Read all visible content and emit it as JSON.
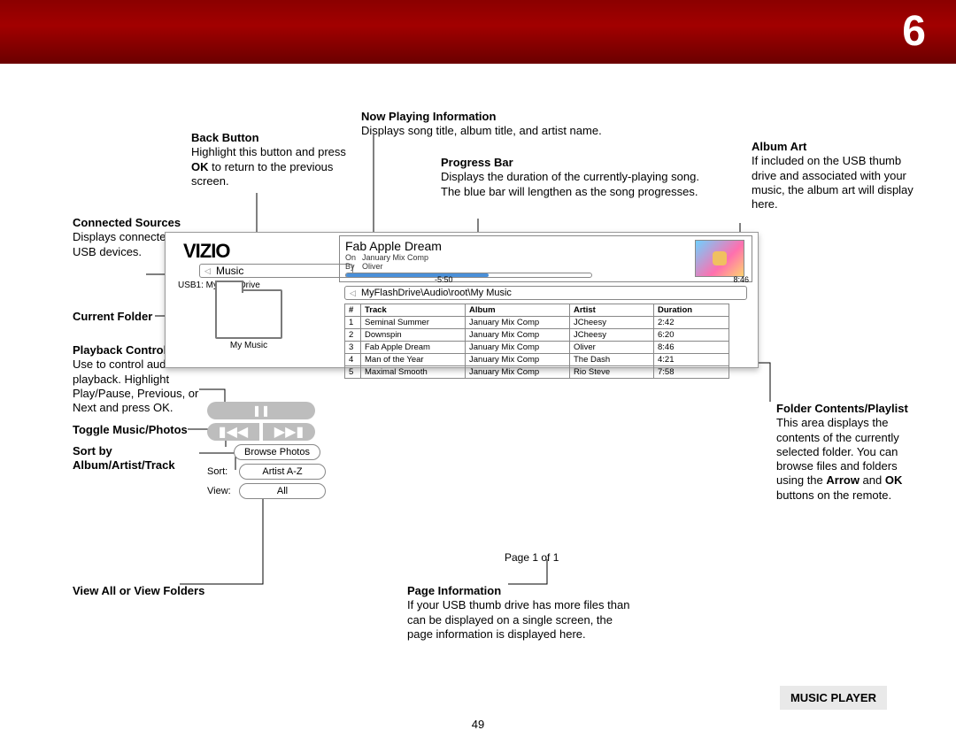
{
  "chapter": "6",
  "page_number": "49",
  "section_label": "MUSIC PLAYER",
  "callouts": {
    "back_button": {
      "title": "Back Button",
      "body": "Highlight this button and press ",
      "bold": "OK",
      "body2": " to return to the previous screen."
    },
    "now_playing": {
      "title": "Now Playing Information",
      "body": "Displays song title, album title, and artist name."
    },
    "progress": {
      "title": "Progress Bar",
      "body": "Displays the duration of the currently-playing song. The blue bar will lengthen as the song progresses."
    },
    "album_art": {
      "title": "Album Art",
      "body": "If included on the USB thumb drive and associated with your music, the album art will display here."
    },
    "connected": {
      "title": "Connected Sources",
      "body": "Displays connected USB devices."
    },
    "current_folder": {
      "title": "Current Folder"
    },
    "playback": {
      "title": "Playback Controls",
      "body": "Use to control audio playback. Highlight Play/Pause, Previous, or Next and press OK."
    },
    "toggle": {
      "title": "Toggle Music/Photos"
    },
    "sort": {
      "title": "Sort by Album/Artist/Track"
    },
    "view": {
      "title": "View All or View Folders"
    },
    "page_info": {
      "title": "Page Information",
      "body": "If your USB thumb drive has more files than can be displayed on a single screen, the page information is displayed here."
    },
    "folder_contents": {
      "title": "Folder Contents/Playlist",
      "body1": "This area displays the contents of the currently selected folder. You can browse files and folders using the ",
      "bold": "Arrow",
      "mid": " and ",
      "bold2": "OK",
      "body2": " buttons on the remote."
    }
  },
  "tv": {
    "logo": "VIZIO",
    "back_label": "Music",
    "source": "USB1: MyFlashDrive",
    "folder": "My Music",
    "now_playing": {
      "title": "Fab Apple Dream",
      "on_label": "On",
      "album": "January Mix Comp",
      "by_label": "By",
      "artist": "Oliver",
      "elapsed": "-5:50",
      "total": "8:46"
    },
    "path": "MyFlashDrive\\Audio\\root\\My Music",
    "headers": [
      "#",
      "Track",
      "Album",
      "Artist",
      "Duration"
    ],
    "rows": [
      [
        "1",
        "Seminal Summer",
        "January Mix Comp",
        "JCheesy",
        "2:42"
      ],
      [
        "2",
        "Downspin",
        "January Mix Comp",
        "JCheesy",
        "6:20"
      ],
      [
        "3",
        "Fab Apple Dream",
        "January Mix Comp",
        "Oliver",
        "8:46"
      ],
      [
        "4",
        "Man of the Year",
        "January Mix Comp",
        "The Dash",
        "4:21"
      ],
      [
        "5",
        "Maximal Smooth",
        "January Mix Comp",
        "Rio Steve",
        "7:58"
      ]
    ],
    "browse_photos": "Browse Photos",
    "sort_label": "Sort:",
    "sort_value": "Artist A-Z",
    "view_label": "View:",
    "view_value": "All",
    "page": "Page 1 of 1"
  }
}
